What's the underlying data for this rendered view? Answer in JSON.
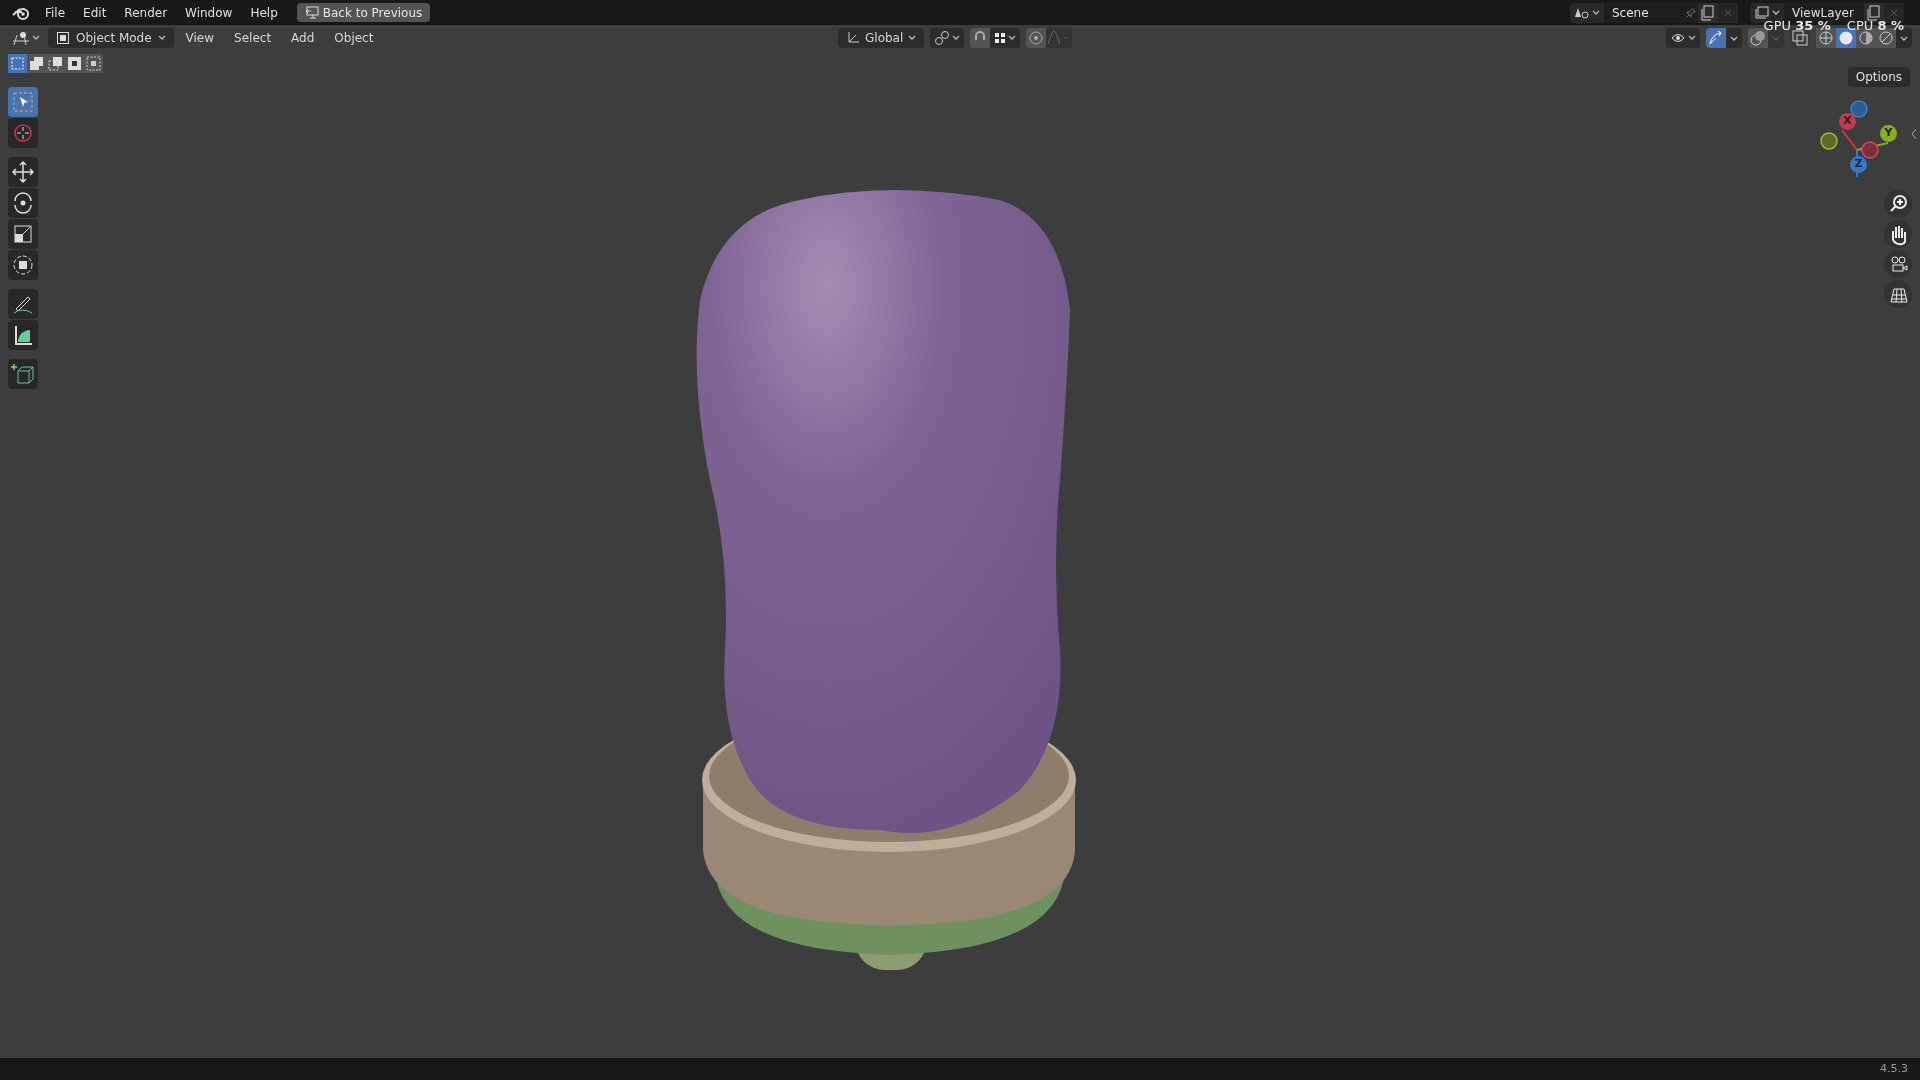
{
  "top_bar": {
    "menus": [
      "File",
      "Edit",
      "Render",
      "Window",
      "Help"
    ],
    "back_button": "Back to Previous",
    "scene": "Scene",
    "view_layer": "ViewLayer"
  },
  "stats": [
    {
      "label": "GPU",
      "value": "35",
      "unit": "%"
    },
    {
      "label": "CPU",
      "value": "8",
      "unit": "%"
    }
  ],
  "header": {
    "mode": "Object Mode",
    "menus": [
      "View",
      "Select",
      "Add",
      "Object"
    ],
    "orientation": "Global",
    "snap_on": false,
    "proportional_on": false,
    "gizmos_on": true,
    "shading": [
      {
        "kind": "wire",
        "selected": false
      },
      {
        "kind": "solid",
        "selected": true
      },
      {
        "kind": "material",
        "selected": false
      },
      {
        "kind": "rendered",
        "selected": false
      }
    ]
  },
  "select_modes": [
    {
      "kind": "new",
      "selected": true
    },
    {
      "kind": "extend",
      "selected": false
    },
    {
      "kind": "subtract",
      "selected": false
    },
    {
      "kind": "invert",
      "selected": false
    },
    {
      "kind": "intersect",
      "selected": false
    }
  ],
  "options": "Options",
  "tools": [
    {
      "kind": "select",
      "selected": true
    },
    {
      "kind": "cursor",
      "selected": false
    },
    {
      "kind": "move",
      "selected": false
    },
    {
      "kind": "rotate",
      "selected": false
    },
    {
      "kind": "scale",
      "selected": false
    },
    {
      "kind": "transform",
      "selected": false
    },
    {
      "kind": "annotate",
      "selected": false
    },
    {
      "kind": "measure",
      "selected": false
    },
    {
      "kind": "add",
      "selected": false
    }
  ],
  "gizmo": {
    "axes": [
      "X",
      "Y",
      "Z"
    ]
  },
  "status_bar": {
    "version": "4.5.3"
  }
}
